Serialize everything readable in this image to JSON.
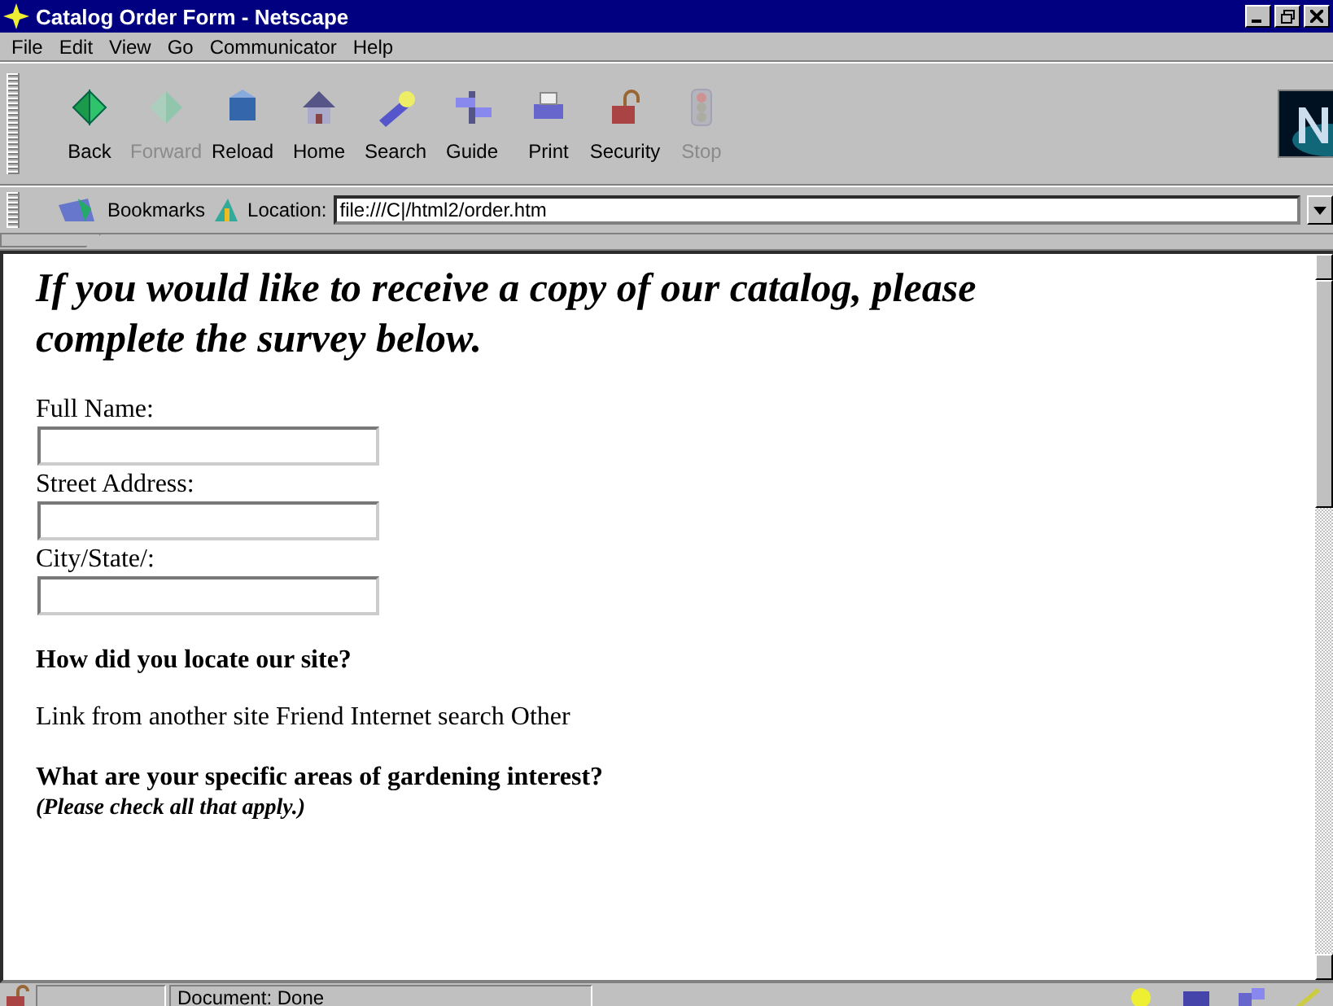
{
  "window": {
    "title": "Catalog Order Form - Netscape"
  },
  "menu": [
    "File",
    "Edit",
    "View",
    "Go",
    "Communicator",
    "Help"
  ],
  "toolbar": [
    {
      "label": "Back",
      "disabled": false
    },
    {
      "label": "Forward",
      "disabled": true
    },
    {
      "label": "Reload",
      "disabled": false
    },
    {
      "label": "Home",
      "disabled": false
    },
    {
      "label": "Search",
      "disabled": false
    },
    {
      "label": "Guide",
      "disabled": false
    },
    {
      "label": "Print",
      "disabled": false
    },
    {
      "label": "Security",
      "disabled": false
    },
    {
      "label": "Stop",
      "disabled": true
    }
  ],
  "location_bar": {
    "bookmarks": "Bookmarks",
    "label": "Location:",
    "value": "file:///C|/html2/order.htm"
  },
  "page": {
    "heading": "If you would like to receive a copy of our catalog, please complete the survey below.",
    "fields": [
      {
        "label": "Full Name:"
      },
      {
        "label": "Street Address:"
      },
      {
        "label": "City/State/:"
      }
    ],
    "question_1": "How did you locate our site?",
    "options_text": "Link from another site Friend Internet search Other",
    "question_2": "What are your specific areas of gardening interest?",
    "note": "(Please check all that apply.)"
  },
  "status_bar": {
    "text": "Document: Done"
  }
}
